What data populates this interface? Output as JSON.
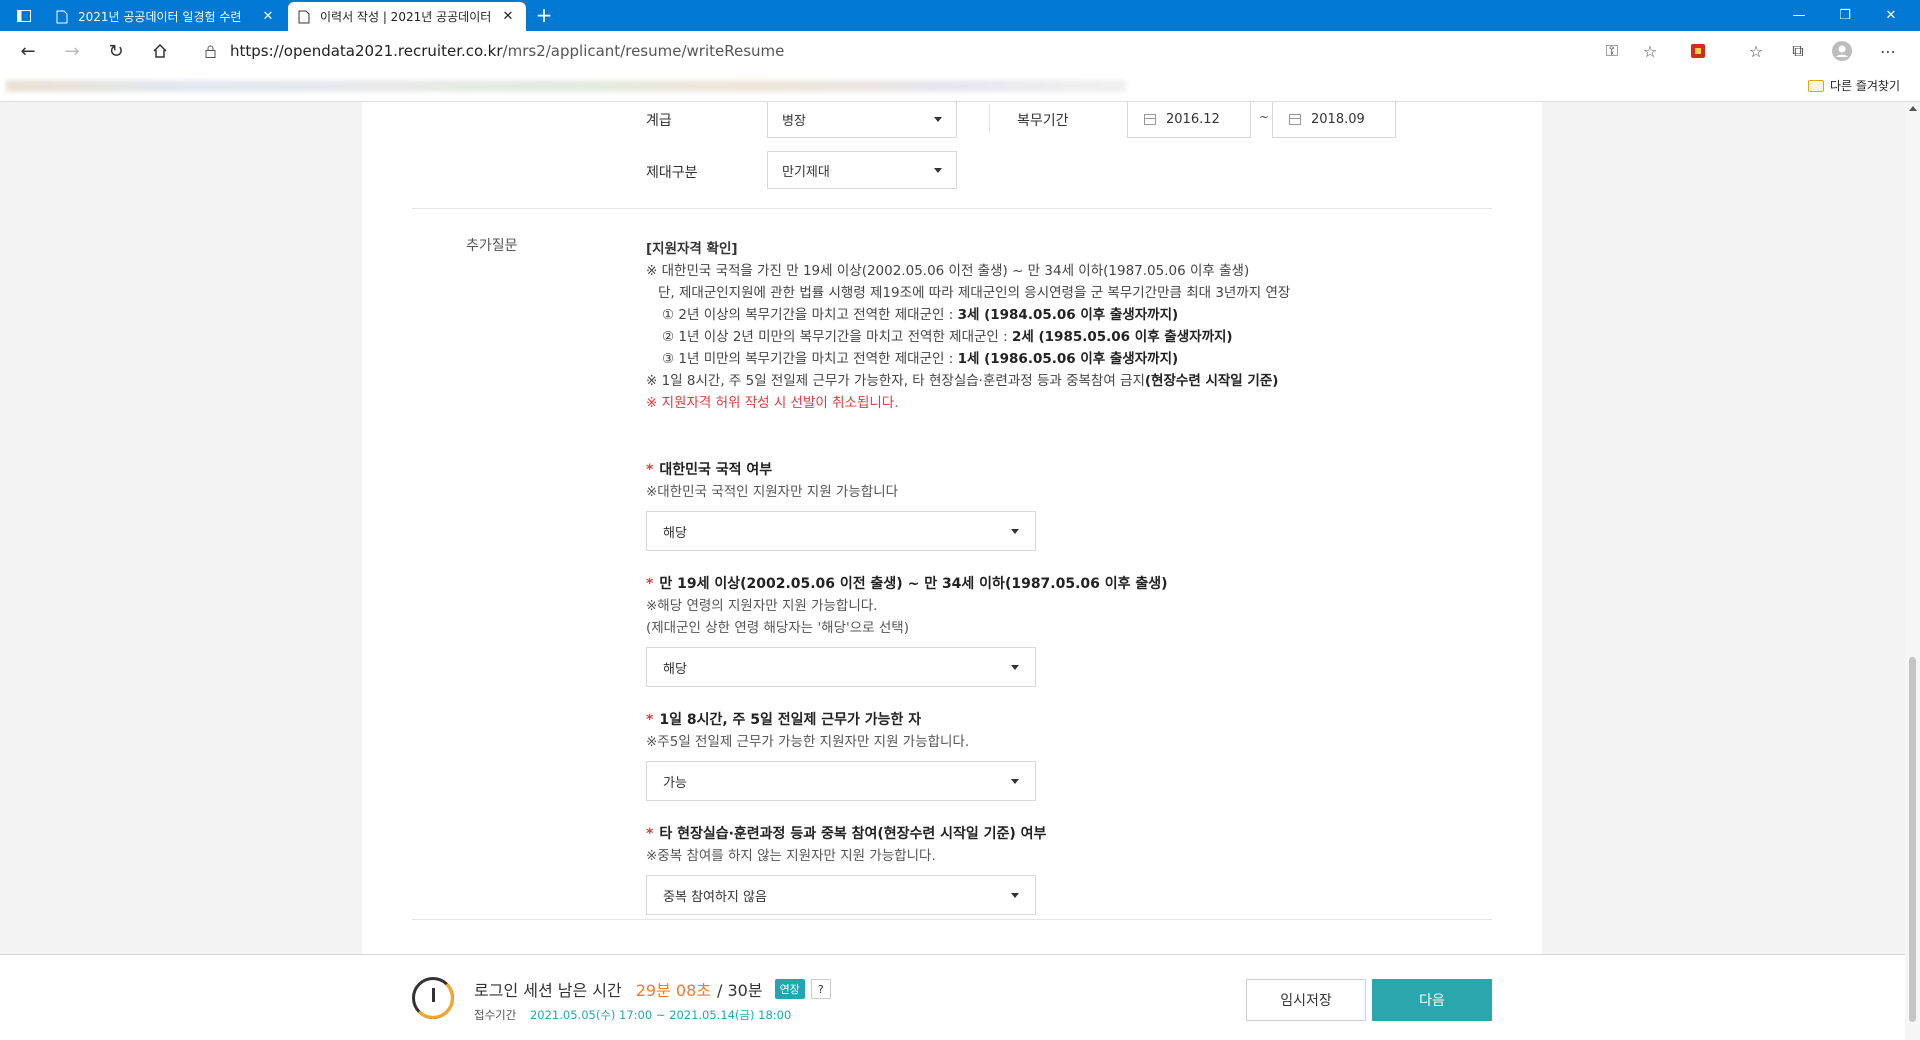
{
  "browser": {
    "tabs": [
      {
        "title": "2021년 공공데이터 일경험 수련",
        "active": false
      },
      {
        "title": "이력서 작성 | 2021년 공공데이터",
        "active": true
      }
    ],
    "url_host": "https://opendata2021.recruiter.co.kr",
    "url_path": "/mrs2/applicant/resume/writeResume",
    "other_bookmarks": "다른 즐겨찾기"
  },
  "military": {
    "rank_label": "계급",
    "rank_value": "병장",
    "period_label": "복무기간",
    "period_start": "2016.12",
    "period_end": "2018.09",
    "tilde": "~",
    "discharge_label": "제대구분",
    "discharge_value": "만기제대"
  },
  "extra": {
    "section_label": "추가질문",
    "info_title": "[지원자격 확인]",
    "info_line1": "※ 대한민국 국적을 가진 만 19세 이상(2002.05.06 이전 출생) ~ 만 34세 이하(1987.05.06 이후 출생)",
    "info_line2": "단, 제대군인지원에 관한 법률 시행령 제19조에 따라 제대군인의 응시연령을 군 복무기간만큼 최대 3년까지 연장",
    "info_item1_text": "① 2년 이상의 복무기간을 마치고 전역한 제대군인 : ",
    "info_item1_bold": "3세 (1984.05.06 이후 출생자까지)",
    "info_item2_text": "② 1년 이상 2년 미만의 복무기간을 마치고 전역한 제대군인 : ",
    "info_item2_bold": "2세 (1985.05.06 이후 출생자까지)",
    "info_item3_text": "③ 1년 미만의 복무기간을 마치고 전역한 제대군인 : ",
    "info_item3_bold": "1세 (1986.05.06 이후 출생자까지)",
    "info_line3_text": "※ 1일 8시간, 주 5일 전일제 근무가 가능한자, 타 현장실습·훈련과정 등과 중복참여 금지",
    "info_line3_bold": "(현장수련 시작일 기준)",
    "info_warning": "※ 지원자격 허위 작성 시 선발이 취소됩니다.",
    "questions": [
      {
        "title": "대한민국 국적 여부",
        "desc1": "※대한민국 국적인 지원자만 지원 가능합니다",
        "desc2": "",
        "value": "해당"
      },
      {
        "title": "만 19세 이상(2002.05.06 이전 출생) ~ 만 34세 이하(1987.05.06 이후 출생)",
        "desc1": "※해당 연령의 지원자만 지원 가능합니다.",
        "desc2": "(제대군인 상한 연령 해당자는 '해당'으로 선택)",
        "value": "해당"
      },
      {
        "title": "1일 8시간, 주 5일 전일제 근무가 가능한 자",
        "desc1": "※주5일 전일제 근무가 가능한 지원자만 지원 가능합니다.",
        "desc2": "",
        "value": "가능"
      },
      {
        "title": "타 현장실습·훈련과정 등과 중복 참여(현장수련 시작일 기준) 여부",
        "desc1": "※중복 참여를 하지 않는 지원자만 지원 가능합니다.",
        "desc2": "",
        "value": "중복 참여하지 않음"
      }
    ],
    "required_mark": "*"
  },
  "footer": {
    "session_label": "로그인 세션 남은 시간",
    "remaining": "29분 08초",
    "total": "/ 30분",
    "extend_badge": "연장",
    "help": "?",
    "period_label": "접수기간",
    "period_dates": "2021.05.05(수) 17:00 ~ 2021.05.14(금) 18:00",
    "save_button": "임시저장",
    "next_button": "다음"
  },
  "colors": {
    "accent": "#2aa6ad",
    "required": "#e03b3b",
    "timer": "#f07b2b",
    "tabbar": "#0078d4"
  }
}
